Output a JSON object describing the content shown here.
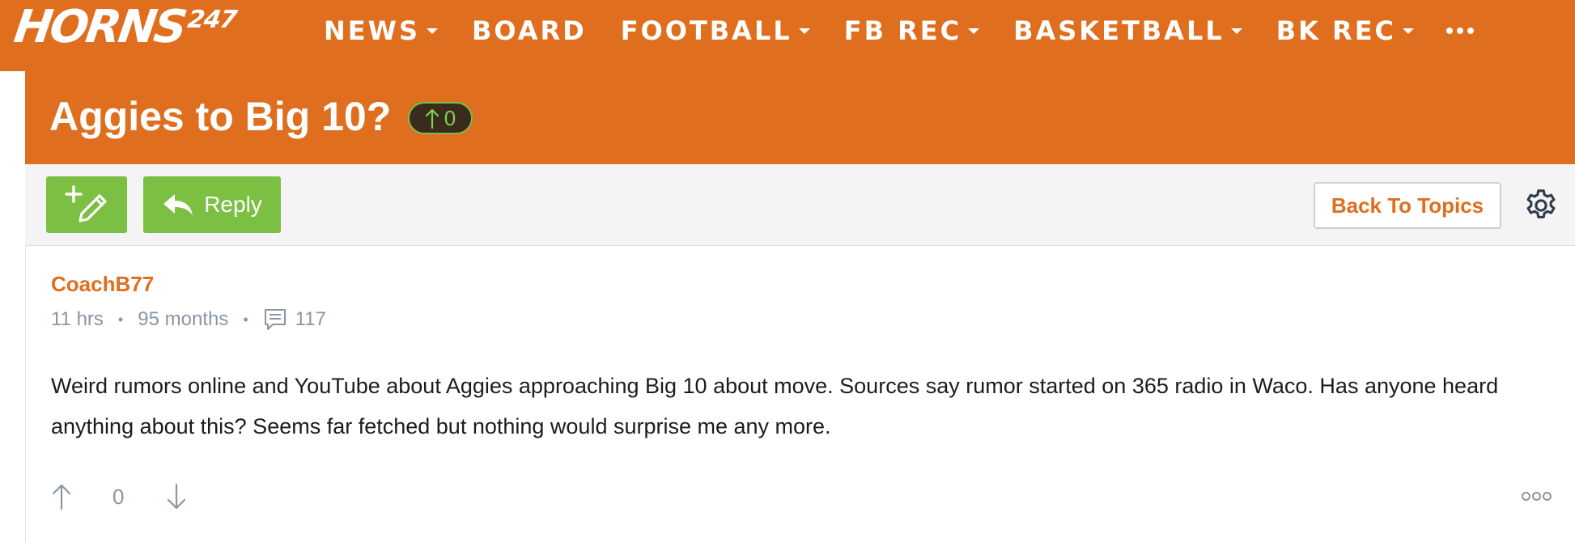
{
  "brand": {
    "logo_word": "HORNS",
    "logo_number": "247"
  },
  "nav": {
    "items": [
      {
        "label": "NEWS",
        "has_dropdown": true
      },
      {
        "label": "BOARD",
        "has_dropdown": false
      },
      {
        "label": "FOOTBALL",
        "has_dropdown": true
      },
      {
        "label": "FB REC",
        "has_dropdown": true
      },
      {
        "label": "BASKETBALL",
        "has_dropdown": true
      },
      {
        "label": "BK REC",
        "has_dropdown": true
      }
    ],
    "more_icon": "ellipsis-icon"
  },
  "thread": {
    "title": "Aggies to Big 10?",
    "upvotes": "0"
  },
  "toolbar": {
    "new_post_icon": "new-post-pencil-icon",
    "reply_label": "Reply",
    "back_label": "Back To Topics",
    "settings_icon": "gear-icon"
  },
  "post": {
    "author": "CoachB77",
    "posted": "11 hrs",
    "member_for": "95 months",
    "post_count": "117",
    "body": "Weird rumors online and YouTube about Aggies approaching Big 10 about move. Sources say rumor started on 365 radio in Waco. Has anyone heard anything about this? Seems far fetched but nothing would surprise me any more.",
    "score": "0"
  },
  "colors": {
    "brand_orange": "#df6e1e",
    "action_green": "#7bc043",
    "muted_gray": "#8a96a3",
    "badge_dark": "#3b2b1c"
  }
}
